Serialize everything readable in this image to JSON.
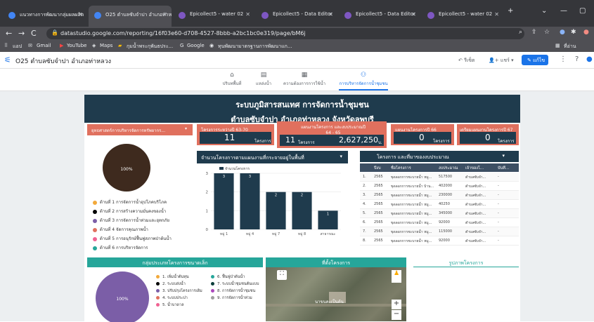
{
  "browser": {
    "tabs": [
      {
        "title": "แนวทางการพัฒนากลุ่มผลผลิต",
        "active": false
      },
      {
        "title": "O25 ตำบลซับจำปา อำเภอท่าห...",
        "active": true
      },
      {
        "title": "Epicollect5 - water 02",
        "active": false
      },
      {
        "title": "Epicollect5 - Data Editor",
        "active": false
      },
      {
        "title": "Epicollect5 - Data Editor",
        "active": false
      },
      {
        "title": "Epicollect5 - water 02",
        "active": false
      }
    ],
    "url": "datastudio.google.com/reporting/16f03e60-d708-4527-8bbb-a2bc1bc0e319/page/bM6j",
    "bookmarks": [
      "แอป",
      "Gmail",
      "YouTube",
      "Maps",
      "กุมน้ำพระกุพันธประ...",
      "Google",
      "ทุนพัฒนามาตรฐานการพัฒนาแก..."
    ],
    "bookmarks_right": "ที่อ่าน"
  },
  "app": {
    "title": "O25 ตำบลซับจำปา อำเภอท่าหลวง",
    "reset": "รีเซ็ต",
    "share": "แชร์",
    "edit": "แก้ไข"
  },
  "pages": [
    {
      "label": "ปริบทพื้นที่",
      "icon": "⌂"
    },
    {
      "label": "แหล่งน้ำ",
      "icon": "▤"
    },
    {
      "label": "ความต้องการการใช้น้ำ",
      "icon": "▦"
    },
    {
      "label": "การบริหารจัดการน้ำชุมชน",
      "icon": "⚇",
      "active": true
    }
  ],
  "report": {
    "title1": "ระบบภูมิสารสนเทศ การจัดการน้ำชุมชน",
    "title2": "ตำบลซับจำปา อำเภอท่าหลวง จังหวัดลพบุรี",
    "strategy_select": "ยุทธศาสตร์การบริหารจัดการทรัพยากร...",
    "kpis": [
      {
        "title": "โครงการระหว่างปี 63-70",
        "value": "11",
        "unit": "โครงการ"
      },
      {
        "title": "แผนงานโครงการ และงบประมาณปี 64 - 65",
        "value": "11",
        "unit": "โครงการ",
        "value2": "2,627,250",
        "unit2": "บ."
      },
      {
        "title": "แผนงานโครงการปี 66",
        "value": "0",
        "unit": "โครงการ"
      },
      {
        "title": "เตรียมแผนงานโครงการปี 67",
        "value": "0",
        "unit": "โครงการ"
      }
    ],
    "pie1_label": "100%",
    "strategies": [
      {
        "text": "ด้านที่ 1 การจัดการน้ำอุปโภคบริโภค",
        "color": "#f2a93b"
      },
      {
        "text": "ด้านที่ 2 การสร้างความมั่นคงของน้ำ",
        "color": "#000000"
      },
      {
        "text": "ด้านที่ 3 การจัดการน้ำท่วมและอุทกภัย",
        "color": "#7b5ea7"
      },
      {
        "text": "ด้านที่ 4 จัดการคุณภาพน้ำ",
        "color": "#e0705e"
      },
      {
        "text": "ด้านที่ 5 การอนุรักษ์ฟื้นฟูสภาพป่าต้นน้ำ",
        "color": "#f06292"
      },
      {
        "text": "ด้านที่ 6 การบริหารจัดการ",
        "color": "#26a69a"
      }
    ],
    "barchart_title": "จำนวนโครงการตามแผนงานที่กระจายอยู่ในพื้นที่",
    "barchart_legend": "จำนวนโครงการ",
    "chart_data": {
      "type": "bar",
      "categories": [
        "หมู่ 1",
        "หมู่ 4",
        "หมู่ 7",
        "หมู่ 8",
        "สาธารณะ"
      ],
      "values": [
        3,
        3,
        2,
        2,
        1
      ],
      "ylim": [
        0,
        3
      ],
      "yticks": [
        "0",
        "1",
        "2",
        "3"
      ]
    },
    "table_title": "โครงการ และที่มาของงบประมาณ",
    "table_headers": [
      "",
      "ปีงบ",
      "ชื่อโครงการ",
      "งบประมาณ",
      "เจ้าของโ...",
      "บันทึ..."
    ],
    "table_rows": [
      [
        "1.",
        "2565",
        "ขุดลอกการชะบายน้ำ หมู...",
        "517500",
        "ตำบลซับจำ...",
        "-"
      ],
      [
        "2.",
        "2565",
        "ขุดลอกการชะบายน้ำ บ้าน...",
        "402000",
        "ตำบลซับจำ...",
        "-"
      ],
      [
        "3.",
        "2565",
        "ขุดลอกการชะบายน้ำ หมู...",
        "230000",
        "ตำบลซับจำ...",
        "-"
      ],
      [
        "4.",
        "2565",
        "ขุดลอกการชะบายน้ำ หมู...",
        "40250",
        "ตำบลซับจำ...",
        "-"
      ],
      [
        "5.",
        "2565",
        "ขุดลอกการชะบายน้ำ หมู...",
        "345000",
        "ตำบลซับจำ...",
        "-"
      ],
      [
        "6.",
        "2565",
        "ขุดลอกการชะบายน้ำ หมู...",
        "92000",
        "ตำบลซับจำ...",
        "-"
      ],
      [
        "7.",
        "2565",
        "ขุดลอกการชะบายน้ำ หมู...",
        "115000",
        "ตำบลซับจำ...",
        "-"
      ],
      [
        "8.",
        "2565",
        "ขุดลอกการชะบายน้ำ หมู...",
        "92000",
        "ตำบลซับจำ...",
        "-"
      ]
    ],
    "smallproj_title": "กลุ่มประเภทโครงการขนาดเล็ก",
    "pie2_label": "100%",
    "small_legend": [
      {
        "text": "1. เพิ่มน้ำต้นทุน",
        "color": "#f2a93b"
      },
      {
        "text": "2. ระบบส่งน้ำ",
        "color": "#000000"
      },
      {
        "text": "3. ปรับปรุงโครงการเดิม",
        "color": "#7b5ea7"
      },
      {
        "text": "4. ระบบประปา",
        "color": "#e0705e"
      },
      {
        "text": "5. น้ำบาดาล",
        "color": "#f06292"
      },
      {
        "text": "6. ฟื้นฟูป่าต้นน้ำ",
        "color": "#26a69a"
      },
      {
        "text": "7. ระบบน้ำชุมชนต้นแบบ",
        "color": "#0b3d3a"
      },
      {
        "text": "8. การจัดการน้ำชุมชน",
        "color": "#ab47bc"
      },
      {
        "text": "9. การจัดการน้ำท่วม",
        "color": "#9e9e9e"
      }
    ],
    "map_title": "ที่ตั้งโครงการ",
    "map_label": "นาขนคะเป็นต้น",
    "photo_title": "รูปภาพโครงการ"
  }
}
